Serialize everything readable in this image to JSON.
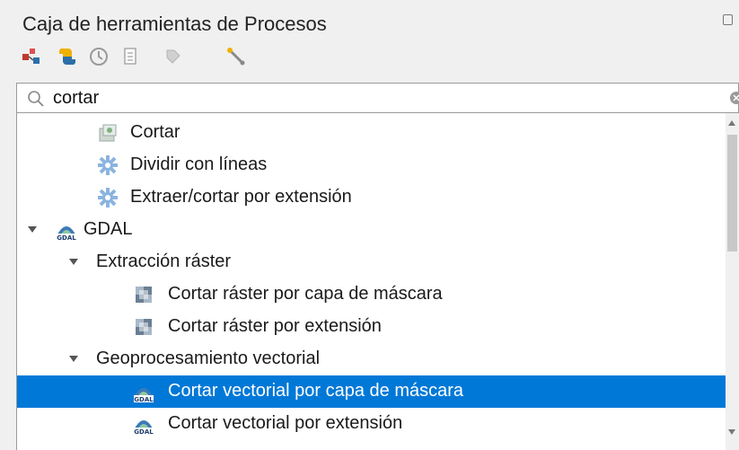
{
  "panel": {
    "title": "Caja de herramientas de Procesos"
  },
  "toolbar": {
    "buttons": [
      {
        "icon": "models-icon"
      },
      {
        "icon": "python-scripts-icon"
      },
      {
        "icon": "history-icon"
      },
      {
        "icon": "results-viewer-icon"
      },
      {
        "icon": "edit-features-icon"
      },
      {
        "icon": "options-icon"
      }
    ]
  },
  "search": {
    "value": "cortar",
    "placeholder": ""
  },
  "tree": {
    "rows": [
      {
        "label": "Cortar",
        "icon": "raster-tool-icon"
      },
      {
        "label": "Dividir con líneas",
        "icon": "gear-icon"
      },
      {
        "label": "Extraer/cortar por extensión",
        "icon": "gear-icon"
      },
      {
        "label": "GDAL",
        "icon": "gdal-icon",
        "expanded": true
      },
      {
        "label": "Extracción ráster",
        "expanded": true
      },
      {
        "label": "Cortar ráster por capa de máscara",
        "icon": "raster-clip-icon"
      },
      {
        "label": "Cortar ráster por extensión",
        "icon": "raster-clip-icon"
      },
      {
        "label": "Geoprocesamiento vectorial",
        "expanded": true
      },
      {
        "label": "Cortar vectorial por capa de máscara",
        "icon": "gdal-icon",
        "selected": true
      },
      {
        "label": "Cortar vectorial por extensión",
        "icon": "gdal-icon"
      }
    ]
  },
  "colors": {
    "selection": "#0078d7",
    "background": "#f0f0f0"
  }
}
